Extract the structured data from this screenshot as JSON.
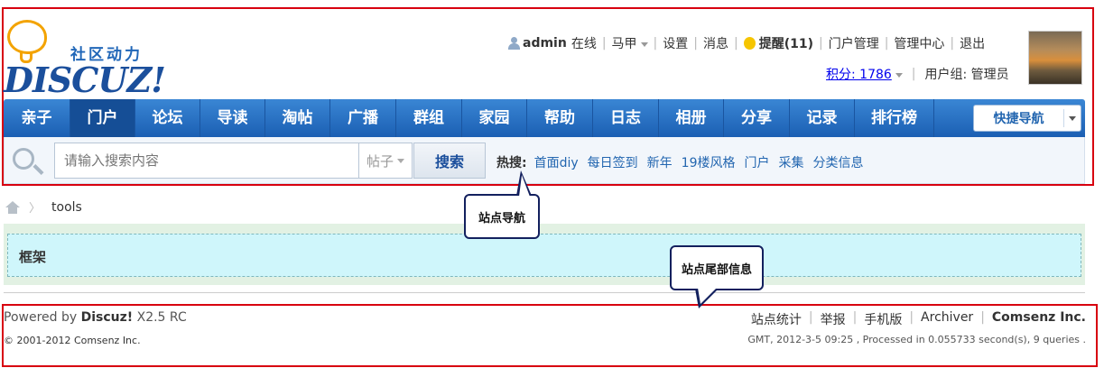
{
  "logo": {
    "cn_text": "社区动力",
    "en_text": "DISCUZ!"
  },
  "userbar": {
    "username": "admin",
    "status": "在线",
    "majia": "马甲",
    "settings": "设置",
    "messages": "消息",
    "remind": "提醒(11)",
    "portal_manage": "门户管理",
    "admin_center": "管理中心",
    "logout": "退出",
    "credits": "积分: 1786",
    "usergroup": "用户组: 管理员"
  },
  "nav": {
    "items": [
      "亲子",
      "门户",
      "论坛",
      "导读",
      "淘帖",
      "广播",
      "群组",
      "家园",
      "帮助",
      "日志",
      "相册",
      "分享",
      "记录",
      "排行榜"
    ],
    "active_index": 1,
    "quick_nav": "快捷导航"
  },
  "search": {
    "placeholder": "请输入搜索内容",
    "type": "帖子",
    "button": "搜索",
    "hot_label": "热搜:",
    "hot_items": [
      "首面diy",
      "每日签到",
      "新年",
      "19楼风格",
      "门户",
      "采集",
      "分类信息"
    ]
  },
  "breadcrumb": {
    "current": "tools"
  },
  "frame": {
    "title": "框架"
  },
  "callouts": {
    "nav": "站点导航",
    "footer": "站点尾部信息"
  },
  "footer": {
    "powered_prefix": "Powered by ",
    "powered_name": "Discuz!",
    "powered_version": " X2.5 RC",
    "copyright": "© 2001-2012 Comsenz Inc.",
    "links": [
      "站点统计",
      "举报",
      "手机版",
      "Archiver",
      "Comsenz Inc."
    ],
    "gmt": "GMT, 2012-3-5 09:25 , Processed in 0.055733 second(s), 9 queries ."
  },
  "colors": {
    "nav_blue": "#1b5fb3",
    "annotation_red": "#d8000f",
    "link_blue": "#2366b0"
  }
}
